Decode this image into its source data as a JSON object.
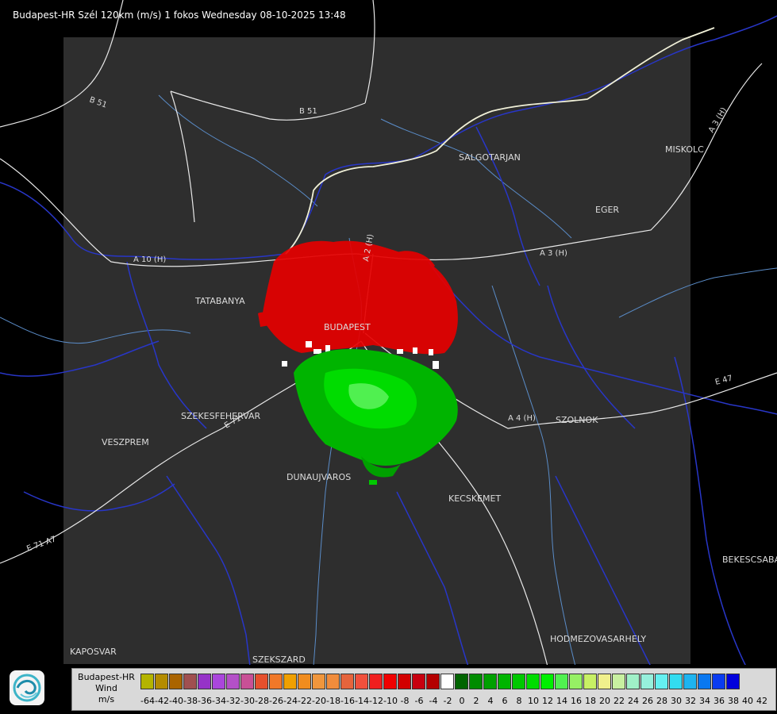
{
  "title": "Budapest-HR Szél 120km (m/s) 1 fokos Wednesday 08-10-2025 13:48",
  "places": [
    "SALGOTARJAN",
    "MISKOLC",
    "EGER",
    "TATABANYA",
    "BUDAPEST",
    "SZEKESFEHERVAR",
    "VESZPREM",
    "DUNAUJVAROS",
    "KECSKEMET",
    "SZOLNOK",
    "BEKESCSABA",
    "HODMEZOVASARHELY",
    "KAPOSVAR",
    "SZEKSZARD"
  ],
  "roads": [
    "B 51",
    "B 51",
    "A 3 (H)",
    "A 3 (H)",
    "A 4 (H)",
    "E 71",
    "A 10 (H)",
    "E 71 A7",
    "E 47",
    "A 2 (H)"
  ],
  "legend": {
    "title_lines": [
      "Budapest-HR",
      "Wind",
      "m/s"
    ],
    "colors": [
      "#b4b400",
      "#b48c00",
      "#aa6400",
      "#a05050",
      "#9632c8",
      "#aa46dc",
      "#b450c8",
      "#c85096",
      "#e6502d",
      "#f07828",
      "#f0a000",
      "#f08c1e",
      "#f0963c",
      "#f08c3c",
      "#e6643c",
      "#f0503c",
      "#f01e1e",
      "#f00000",
      "#d20000",
      "#c8000f",
      "#b40000",
      "#ffffff",
      "#006400",
      "#008c00",
      "#00a000",
      "#00b400",
      "#00c800",
      "#00dc00",
      "#00f000",
      "#50f050",
      "#96f064",
      "#c8f064",
      "#f0f08c",
      "#c8f0a0",
      "#a0f0c8",
      "#96f0dc",
      "#64f0f0",
      "#32dcf0",
      "#1eb4f0",
      "#0a78f0",
      "#0a3cf0",
      "#0000dc"
    ],
    "ticks": [
      "-64",
      "-42",
      "-40",
      "-38",
      "-36",
      "-34",
      "-32",
      "-30",
      "-28",
      "-26",
      "-24",
      "-22",
      "-20",
      "-18",
      "-16",
      "-14",
      "-12",
      "-10",
      "-8",
      "-6",
      "-4",
      "-2",
      "0",
      "2",
      "4",
      "6",
      "8",
      "10",
      "12",
      "14",
      "16",
      "18",
      "20",
      "22",
      "24",
      "26",
      "28",
      "30",
      "32",
      "34",
      "36",
      "38",
      "40",
      "42"
    ]
  }
}
